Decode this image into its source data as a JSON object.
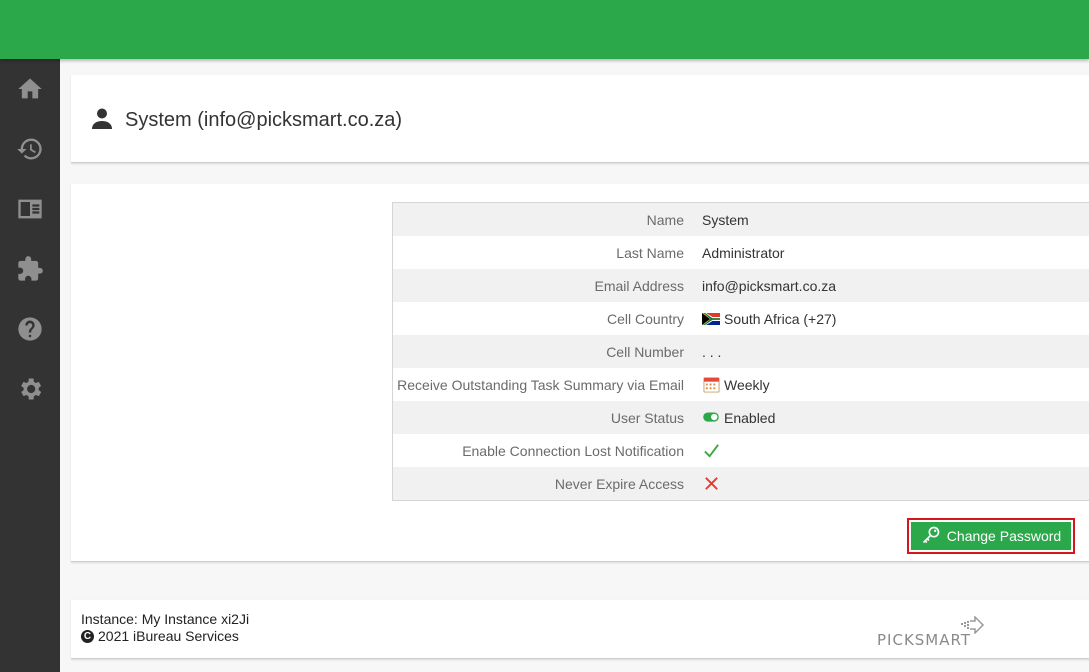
{
  "colors": {
    "brand_green": "#2ba84a",
    "sidebar_bg": "#333333",
    "highlight_red": "#d9141a"
  },
  "sidebar": {
    "items": [
      {
        "icon": "home-icon"
      },
      {
        "icon": "history-icon"
      },
      {
        "icon": "card-icon"
      },
      {
        "icon": "puzzle-icon"
      },
      {
        "icon": "help-icon"
      },
      {
        "icon": "gear-icon"
      }
    ]
  },
  "header": {
    "title": "System (info@picksmart.co.za)",
    "icon": "user-icon"
  },
  "details": [
    {
      "label": "Name",
      "value": "System"
    },
    {
      "label": "Last Name",
      "value": "Administrator"
    },
    {
      "label": "Email Address",
      "value": "info@picksmart.co.za"
    },
    {
      "label": "Cell Country",
      "value": "South Africa (+27)",
      "icon": "south-africa-flag-icon"
    },
    {
      "label": "Cell Number",
      "value": ". . ."
    },
    {
      "label": "Receive Outstanding Task Summary via Email",
      "value": "Weekly",
      "icon": "calendar-icon"
    },
    {
      "label": "User Status",
      "value": "Enabled",
      "icon": "toggle-on-icon"
    },
    {
      "label": "Enable Connection Lost Notification",
      "value": "",
      "icon": "checkmark-icon"
    },
    {
      "label": "Never Expire Access",
      "value": "",
      "icon": "cross-icon"
    }
  ],
  "actions": {
    "change_password_label": "Change Password",
    "icon": "key-icon"
  },
  "footer": {
    "instance": "Instance: My Instance xi2Ji",
    "copyright_symbol": "C",
    "copyright": "2021 iBureau Services",
    "logo_text": "PICKSMART"
  }
}
